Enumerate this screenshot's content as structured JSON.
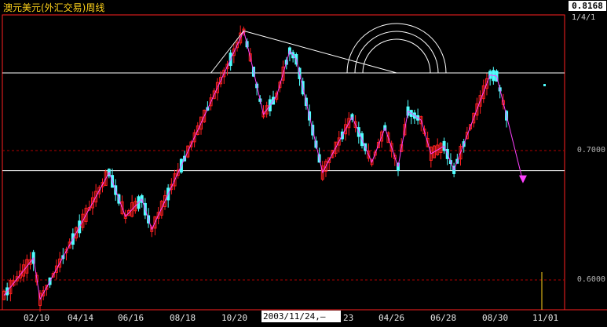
{
  "window": {
    "title": "澳元美元(外汇交易)周线"
  },
  "y_axis": {
    "top_value": "0.8168",
    "sub_label": "1/4/1",
    "labels": [
      "0.7000",
      "0.6000"
    ]
  },
  "x_axis": {
    "labels": [
      "02/10",
      "04/14",
      "06/16",
      "08/18",
      "10/20",
      "23",
      "04/26",
      "06/28",
      "08/30",
      "11/01"
    ],
    "cursor_date": "2003/11/24,—"
  },
  "colors": {
    "up_candle": "#ff2020",
    "down_candle": "#50ffff",
    "zigzag": "#ff40ff",
    "frame": "#ff2020",
    "guide_line": "#ffffff",
    "title": "#ffd21a"
  },
  "chart_data": {
    "type": "candlestick",
    "title": "澳元美元(外汇交易)周线",
    "x_tick_labels": [
      "02/10",
      "04/14",
      "06/16",
      "08/18",
      "10/20",
      "23",
      "04/26",
      "06/28",
      "08/30",
      "11/01"
    ],
    "y_tick_labels": [
      "0.6000",
      "0.7000",
      "0.8168"
    ],
    "ylim": [
      0.58,
      0.8168
    ],
    "reference_levels": [
      0.6,
      0.7
    ],
    "horizontal_lines": [
      0.76,
      0.6845
    ],
    "zigzag_price": [
      0.588,
      0.617,
      0.585,
      0.683,
      0.649,
      0.6625,
      0.639,
      0.7925,
      0.772,
      0.728,
      0.742,
      0.777,
      0.7705,
      0.683,
      0.707,
      0.726,
      0.691,
      0.7175,
      0.6875,
      0.7305,
      0.7235,
      0.6975,
      0.7035,
      0.685,
      0.7585,
      0.7575,
      0.676
    ]
  }
}
